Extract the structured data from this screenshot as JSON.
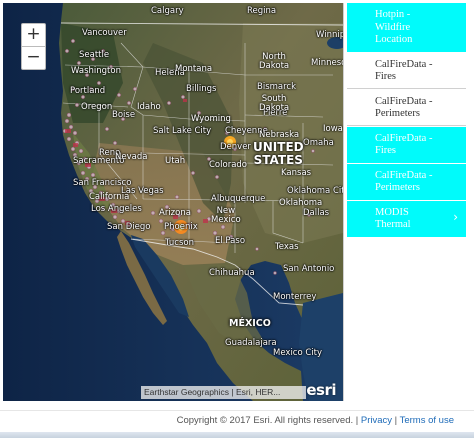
{
  "map": {
    "zoom_in_label": "+",
    "zoom_out_label": "−",
    "attribution": "Earthstar Geographics | Esri, HER...",
    "logo": "esri",
    "cities": [
      {
        "name": "Seattle"
      },
      {
        "name": "Calgary"
      },
      {
        "name": "Vancouver"
      },
      {
        "name": "Regina"
      },
      {
        "name": "Winnipeg"
      },
      {
        "name": "Portland"
      },
      {
        "name": "Bismarck"
      },
      {
        "name": "Billings"
      },
      {
        "name": "Boise"
      },
      {
        "name": "Denver"
      },
      {
        "name": "Salt Lake City"
      },
      {
        "name": "Reno"
      },
      {
        "name": "Sacramento"
      },
      {
        "name": "San Francisco"
      },
      {
        "name": "Las Vegas"
      },
      {
        "name": "Los Angeles"
      },
      {
        "name": "San Diego"
      },
      {
        "name": "Phoenix"
      },
      {
        "name": "Tucson"
      },
      {
        "name": "El Paso"
      },
      {
        "name": "Dallas"
      },
      {
        "name": "San Antonio"
      },
      {
        "name": "Monterrey"
      },
      {
        "name": "Guadalajara"
      },
      {
        "name": "Mexico City"
      },
      {
        "name": "Chihuahua"
      },
      {
        "name": "Albuquerque"
      },
      {
        "name": "Oklahoma City"
      },
      {
        "name": "Cheyenne"
      },
      {
        "name": "Helena"
      },
      {
        "name": "Pierre"
      },
      {
        "name": "Omaha"
      }
    ],
    "regions": [
      {
        "name": "Washington"
      },
      {
        "name": "Montana"
      },
      {
        "name": "North\nDakota"
      },
      {
        "name": "Minnesota"
      },
      {
        "name": "Oregon"
      },
      {
        "name": "Idaho"
      },
      {
        "name": "South\nDakota"
      },
      {
        "name": "Wyoming"
      },
      {
        "name": "Nebraska"
      },
      {
        "name": "Iowa"
      },
      {
        "name": "Nevada"
      },
      {
        "name": "Utah"
      },
      {
        "name": "Colorado"
      },
      {
        "name": "Kansas"
      },
      {
        "name": "California"
      },
      {
        "name": "Arizona"
      },
      {
        "name": "New\nMexico"
      },
      {
        "name": "Oklahoma"
      },
      {
        "name": "Texas"
      }
    ],
    "countries": [
      {
        "name": "UNITED\nSTATES"
      },
      {
        "name": "MÉXICO"
      }
    ]
  },
  "layers": [
    {
      "label": "Hotpin - Wildfire Location",
      "active": true,
      "chevron": ""
    },
    {
      "label": "CalFireData - Fires",
      "active": false,
      "chevron": ""
    },
    {
      "label": "CalFireData - Perimeters",
      "active": false,
      "chevron": ""
    },
    {
      "label": "CalFireData - Fires",
      "active": true,
      "chevron": ""
    },
    {
      "label": "CalFireData - Perimeters",
      "active": true,
      "chevron": ""
    },
    {
      "label": "MODIS Thermal",
      "active": true,
      "chevron": "›"
    }
  ],
  "footer": {
    "copyright": "Copyright © 2017 Esri. All rights reserved.",
    "separator": "|",
    "privacy": "Privacy",
    "terms": "Terms of use"
  },
  "colors": {
    "accent": "#00fbfb",
    "ocean": "#1d3b62",
    "link": "#1e6bb8",
    "fire_marker": "#f5a623"
  }
}
